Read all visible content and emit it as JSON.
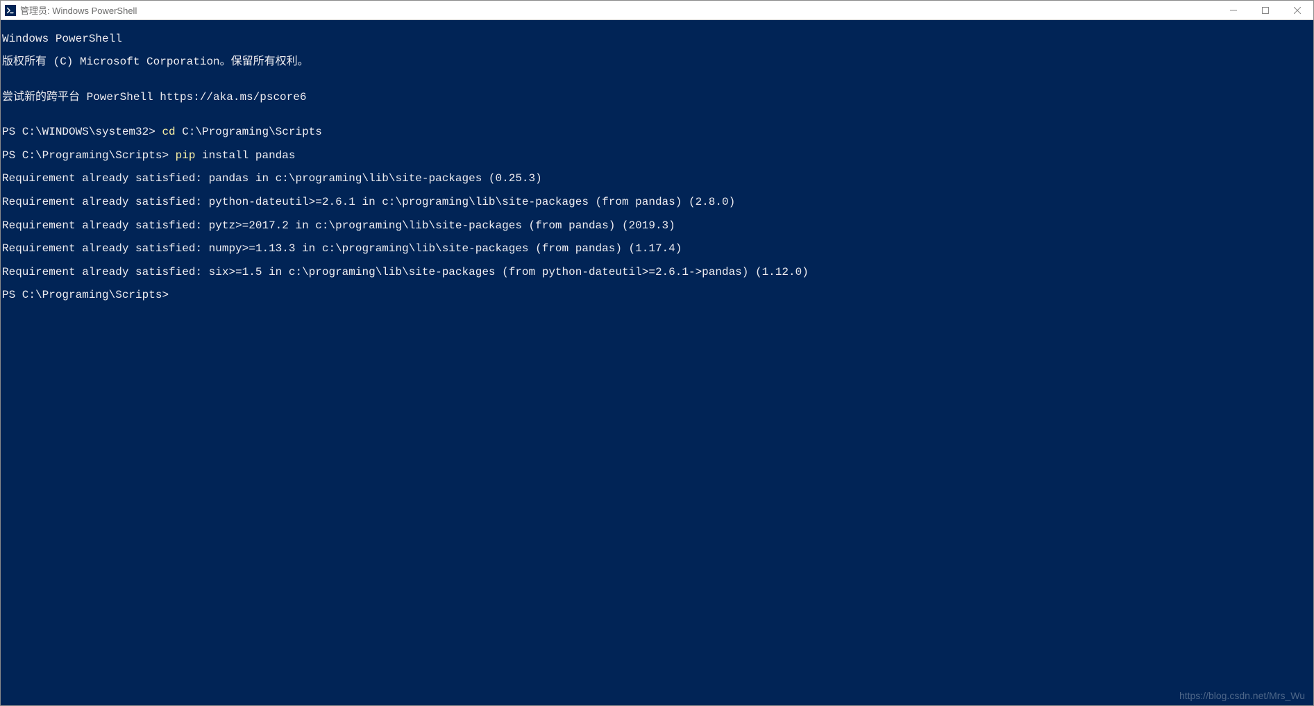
{
  "titlebar": {
    "title": "管理员: Windows PowerShell"
  },
  "terminal": {
    "lines": {
      "l0": "Windows PowerShell",
      "l1": "版权所有 (C) Microsoft Corporation。保留所有权利。",
      "l2": "",
      "l3": "尝试新的跨平台 PowerShell https://aka.ms/pscore6",
      "l4": "",
      "p1_prompt": "PS C:\\WINDOWS\\system32> ",
      "p1_cmd": "cd ",
      "p1_arg": "C:\\Programing\\Scripts",
      "p2_prompt": "PS C:\\Programing\\Scripts> ",
      "p2_cmd": "pip ",
      "p2_arg": "install pandas",
      "l7": "Requirement already satisfied: pandas in c:\\programing\\lib\\site-packages (0.25.3)",
      "l8": "Requirement already satisfied: python-dateutil>=2.6.1 in c:\\programing\\lib\\site-packages (from pandas) (2.8.0)",
      "l9": "Requirement already satisfied: pytz>=2017.2 in c:\\programing\\lib\\site-packages (from pandas) (2019.3)",
      "l10": "Requirement already satisfied: numpy>=1.13.3 in c:\\programing\\lib\\site-packages (from pandas) (1.17.4)",
      "l11": "Requirement already satisfied: six>=1.5 in c:\\programing\\lib\\site-packages (from python-dateutil>=2.6.1->pandas) (1.12.0)",
      "p3_prompt": "PS C:\\Programing\\Scripts>"
    }
  },
  "watermark": "https://blog.csdn.net/Mrs_Wu"
}
